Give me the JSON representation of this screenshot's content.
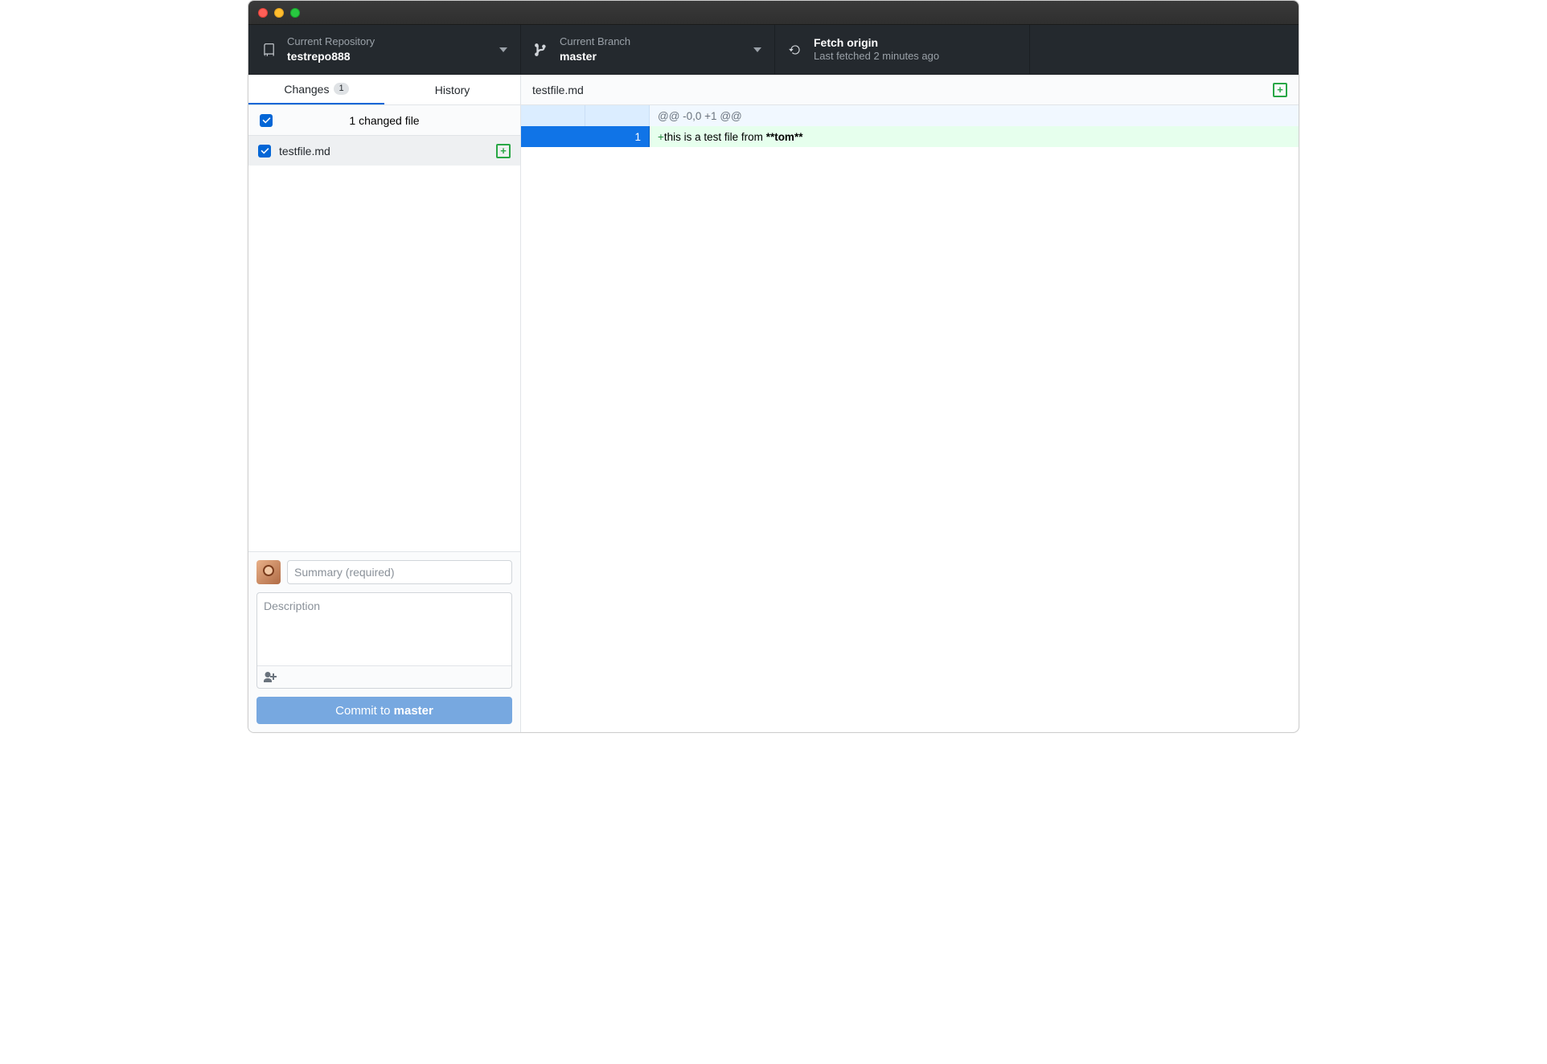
{
  "toolbar": {
    "repo": {
      "label": "Current Repository",
      "value": "testrepo888"
    },
    "branch": {
      "label": "Current Branch",
      "value": "master"
    },
    "fetch": {
      "label": "Fetch origin",
      "sub": "Last fetched 2 minutes ago"
    }
  },
  "sidebar": {
    "tabs": {
      "changes": "Changes",
      "changes_count": "1",
      "history": "History"
    },
    "summary_line": "1 changed file",
    "files": [
      {
        "name": "testfile.md",
        "status": "+"
      }
    ]
  },
  "commit": {
    "summary_placeholder": "Summary (required)",
    "description_placeholder": "Description",
    "button_prefix": "Commit to ",
    "button_branch": "master"
  },
  "diff": {
    "file": "testfile.md",
    "status": "+",
    "hunk": "@@ -0,0 +1 @@",
    "lines": [
      {
        "old": "",
        "new": "1",
        "prefix": "+",
        "text": "this is a test file from ",
        "bold": "**tom**"
      }
    ]
  }
}
